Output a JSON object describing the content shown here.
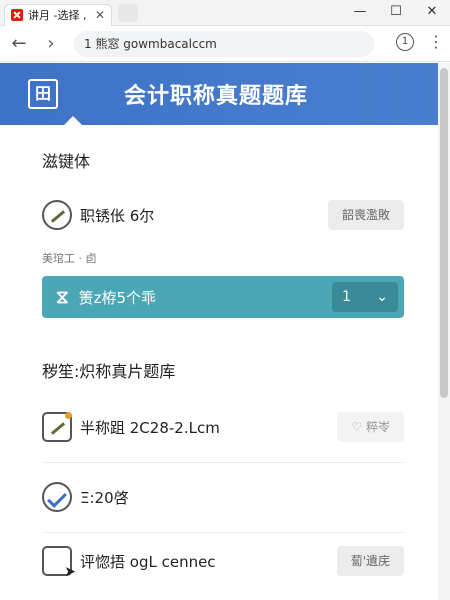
{
  "browser": {
    "tab_title": "讲月 -选择 ,",
    "tab_close": "✕",
    "minimize": "—",
    "maximize": "☐",
    "close": "✕",
    "back": "←",
    "forward": "›",
    "reload": "C",
    "url": "1 熊窓  gowmbacalccm",
    "info": "1",
    "menu": "⋮"
  },
  "app": {
    "logo": "田",
    "title": "会计职称真题题库"
  },
  "section1": {
    "title": "滋键体",
    "row1_text": "职锈伥 6尔",
    "row1_button": "韶喪濫敗",
    "label": "美琯工 · 卣",
    "teal_text": "箦z栫5个乖",
    "teal_select_value": "1"
  },
  "section2": {
    "title": "秽笙:炽称真片题库",
    "items": [
      {
        "text": "半称跙 2C28-2.Lcm",
        "button": "♡ 粹岺"
      },
      {
        "text": "Ξ:20啓",
        "button": ""
      },
      {
        "text": "评惚捂 ogL cennec",
        "button": "蔔'遺庑"
      }
    ]
  },
  "colors": {
    "header": "#3d72c6",
    "teal": "#4ba7b5"
  }
}
